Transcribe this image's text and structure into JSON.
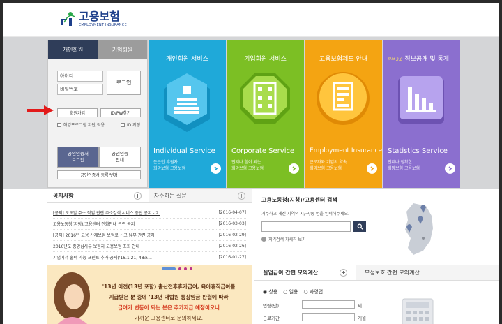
{
  "logo": {
    "title": "고용보험",
    "subtitle": "EMPLOYMENT INSURANCE"
  },
  "login": {
    "tab_personal": "개인회원",
    "tab_corporate": "기업회원",
    "id_placeholder": "아이디",
    "pw_placeholder": "비밀번호",
    "login_button": "로그인",
    "signup_button": "회원가입",
    "find_button": "ID/PW찾기",
    "hacking_check": "해킹프로그램 차단 적용",
    "save_id": "ID 저장",
    "cert_login_1": "공인인증서",
    "cert_login_2": "로그인",
    "cert_info_1": "공인인증",
    "cert_info_2": "안내",
    "cert_register": "공인인증서 등록/변경"
  },
  "tiles": [
    {
      "title": "개인회원 서비스",
      "en": "Individual Service",
      "ko1": "든든한 후원자",
      "ko2": "희망보험 고용보험",
      "color": "#1fa9d9"
    },
    {
      "title": "기업회원 서비스",
      "en": "Corporate Service",
      "ko1": "언제나 힘이 되는",
      "ko2": "희망보험 고용보험",
      "color": "#7cbf24"
    },
    {
      "title": "고용보험제도 안내",
      "en": "Employment Insurance",
      "ko1": "근로자와 기업의 약속",
      "ko2": "희망보험 고용보험",
      "color": "#f4a412"
    },
    {
      "title": "정보공개 및 통계",
      "title_prefix": "정부 3.0",
      "en": "Statistics Service",
      "ko1": "언제나 정확한",
      "ko2": "희망보험 고용보험",
      "color": "#8b6fcf"
    }
  ],
  "notice": {
    "tab1": "공지사항",
    "tab2": "자주하는 질문",
    "plus": "+",
    "items": [
      {
        "title": "[공지] 토요일 주소 작업 관련 주소검색 서비스 중단 공지 - 2.",
        "date": "[2016-04-07]"
      },
      {
        "title": "고용노동청(지청)/고용센터 전화안내 관련 공지",
        "date": "[2016-03-03]"
      },
      {
        "title": "[공지] 2016년 고용 산재보험 보험료 신고 납부 관련 공지",
        "date": "[2016-02-29]"
      },
      {
        "title": "2016년도 중앙심사부 보험자 고용보험 조회 안내",
        "date": "[2016-02-26]"
      },
      {
        "title": "기업에서 출력 가능 프린트 추가 공지('16.1.21, 48호...",
        "date": "[2016-01-27]"
      }
    ]
  },
  "center": {
    "title": "고용노동청(지청)/고용센터 검색",
    "desc": "거주하고 계신 지역의 시/구/동 명을 입력해주세요.",
    "detail_link": "지역검색 자세히 보기"
  },
  "banner": {
    "line1": "'13년 이전(13년 포함) 출산전후휴가급여, 육아휴직급여를",
    "line2": "지급받은 분 중에 '13년 대법원 통상임금 판결에 따라",
    "line3": "급여가 변동이 되는 분은 추가지급 예정이오니",
    "line4": "가까운 고용센터로 문의하세요."
  },
  "calc": {
    "tab1": "실업급여 간편 모의계산",
    "tab2": "모성보호 간편 모의계산",
    "radio1": "상용",
    "radio2": "일용",
    "radio3": "자영업",
    "age_label": "연령(만)",
    "age_unit": "세",
    "period_label": "근로기간",
    "period_unit": "개월"
  }
}
